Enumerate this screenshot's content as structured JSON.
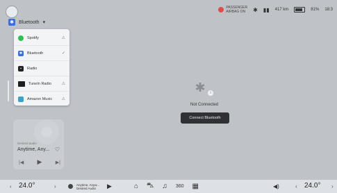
{
  "status": {
    "airbag_line1": "PASSENGER",
    "airbag_line2": "AIRBAG ON",
    "bluetooth_icon": "✱",
    "signal_icon": "▮▮",
    "range": "417 km",
    "battery_percent": "81%",
    "time": "18:3"
  },
  "source_selector": {
    "label": "Bluetooth",
    "chevron": "▾"
  },
  "menu": {
    "items": [
      {
        "label": "Spotify",
        "right": "⚠"
      },
      {
        "label": "Bluetooth",
        "right": "✓"
      },
      {
        "label": "Radio",
        "right": ""
      },
      {
        "label": "TuneIn Radio",
        "right": "⚠"
      },
      {
        "label": "Amazon Music",
        "right": "⚠"
      }
    ]
  },
  "center": {
    "bluetooth_glyph": "✱",
    "info_glyph": "i",
    "status_text": "Not Connected",
    "connect_button": "Connect Bluetooth"
  },
  "now_playing": {
    "desired_audio": "Desired audio",
    "title": "Anytime, Any...",
    "heart": "♡",
    "prev": "|◀",
    "play": "▶",
    "next": "▶|"
  },
  "bottom": {
    "temp_left": "24.0°",
    "temp_right": "24.0°",
    "chev_left": "‹",
    "chev_left2": "›",
    "chev_right": "‹",
    "chev_right2": "›",
    "mini_title": "Anytime, Anyw...",
    "mini_sub": "Desired Audio",
    "mini_play": "▶",
    "home": "⌂",
    "car": "⛍",
    "music": "♫",
    "view360": "360",
    "apps": "▦",
    "volume": "◀)"
  },
  "colors": {
    "background": "#bfc3c8",
    "menu_bg": "#f3f4f6",
    "accent_blue": "#3b6fe0",
    "spotify_green": "#2fbf53",
    "button_dark": "#2f3135"
  }
}
